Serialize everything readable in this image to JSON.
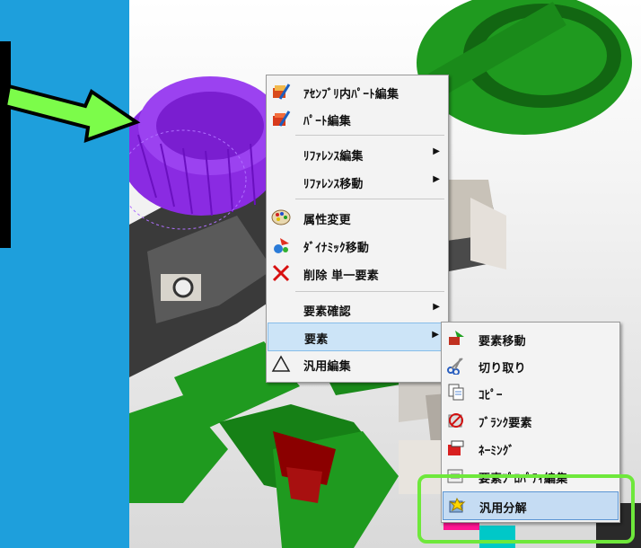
{
  "context_menu": {
    "items": [
      {
        "label": "ｱｾﾝﾌﾞﾘ内ﾊﾟｰﾄ編集",
        "icon": "assembly-part-edit-icon"
      },
      {
        "label": "ﾊﾟｰﾄ編集",
        "icon": "part-edit-icon"
      },
      {
        "label": "ﾘﾌｧﾚﾝｽ編集",
        "submenu": true
      },
      {
        "label": "ﾘﾌｧﾚﾝｽ移動",
        "submenu": true
      },
      {
        "label": "属性変更",
        "icon": "attribute-change-icon"
      },
      {
        "label": "ﾀﾞｲﾅﾐｯｸ移動",
        "icon": "dynamic-move-icon"
      },
      {
        "label": "削除 単一要素",
        "icon": "delete-icon"
      },
      {
        "label": "要素確認",
        "submenu": true
      },
      {
        "label": "要素",
        "submenu": true,
        "highlighted": true
      },
      {
        "label": "汎用編集",
        "icon": "triangle-icon"
      }
    ]
  },
  "submenu": {
    "items": [
      {
        "label": "要素移動",
        "icon": "element-move-icon"
      },
      {
        "label": "切り取り",
        "icon": "scissors-icon"
      },
      {
        "label": "ｺﾋﾟｰ",
        "icon": "copy-icon"
      },
      {
        "label": "ﾌﾞﾗﾝｸ要素",
        "icon": "blank-element-icon"
      },
      {
        "label": "ﾈｰﾐﾝｸﾞ",
        "icon": "naming-icon"
      },
      {
        "label": "要素ﾌﾟﾛﾊﾟﾃｨ編集",
        "icon": "element-property-icon"
      },
      {
        "label": "汎用分解",
        "icon": "explode-icon",
        "highlighted": true
      }
    ]
  },
  "annotations": {
    "arrow_color": "#7cfc4a",
    "highlight_box_color": "#6ee83b"
  },
  "colors": {
    "background": "#1e9fdc",
    "part_green": "#1f9a1f",
    "part_purple": "#8a2be2",
    "part_gray": "#4a4a4a",
    "menu_bg": "#f3f3f3",
    "menu_highlight": "#cce4f7"
  }
}
